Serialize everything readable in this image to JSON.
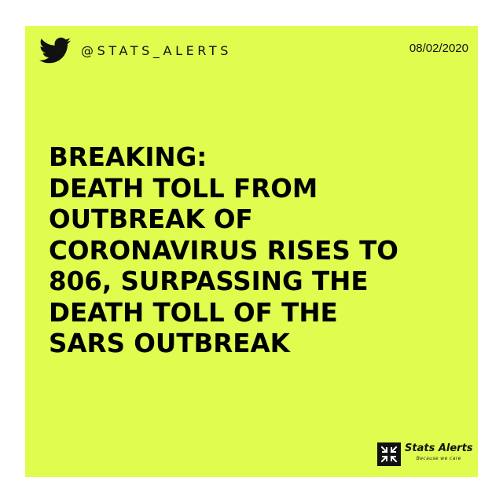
{
  "header": {
    "icon": "twitter-bird-icon",
    "handle": "@STATS_ALERTS",
    "date": "08/02/2020"
  },
  "headline": {
    "lines": [
      "BREAKING:",
      "DEATH TOLL FROM",
      "OUTBREAK OF",
      "CORONAVIRUS RISES TO",
      "806, SURPASSING THE",
      "DEATH TOLL OF THE",
      "SARS OUTBREAK"
    ]
  },
  "brand": {
    "icon": "stats-alerts-logo-icon",
    "name": "Stats Alerts",
    "tagline": "Because we care"
  },
  "colors": {
    "background": "#dffc4f",
    "text": "#000000",
    "page": "#ffffff"
  }
}
